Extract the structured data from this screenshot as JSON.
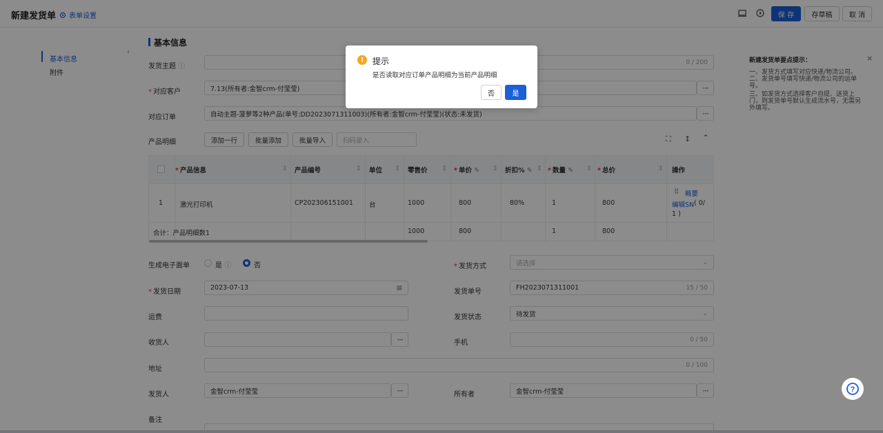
{
  "header": {
    "title": "新建发货单",
    "form_settings": "表单设置",
    "save": "保 存",
    "draft": "存草稿",
    "cancel": "取 消"
  },
  "nav": {
    "items": [
      "基本信息",
      "附件"
    ]
  },
  "section": {
    "title": "基本信息"
  },
  "form": {
    "subject_label": "发货主题",
    "subject_count": "0 / 200",
    "customer_label": "对应客户",
    "customer_value": "7.13(所有者:金智crm-付莹莹)",
    "order_label": "对应订单",
    "order_value": "自动主题-菠萝等2种产品(单号:DD2023071311003)(所有者:金智crm-付莹莹)(状态:未发货)",
    "product_detail_label": "产品明细",
    "add_row": "添加一行",
    "batch_add": "批量添加",
    "batch_import": "批量导入",
    "scan_placeholder": "扫码录入",
    "e_waybill_label": "生成电子面单",
    "e_waybill_yes": "是",
    "e_waybill_no": "否",
    "shipping_method_label": "发货方式",
    "shipping_method_placeholder": "请选择",
    "ship_date_label": "发货日期",
    "ship_date_value": "2023-07-13",
    "ship_no_label": "发货单号",
    "ship_no_value": "FH2023071311001",
    "ship_no_count": "15 / 50",
    "freight_label": "运费",
    "ship_status_label": "发货状态",
    "ship_status_value": "待发货",
    "receiver_label": "收货人",
    "phone_label": "手机",
    "phone_count": "0 / 50",
    "address_label": "地址",
    "address_count": "0 / 100",
    "sender_label": "发货人",
    "sender_value": "金智crm-付莹莹",
    "owner_label": "所有者",
    "owner_value": "金智crm-付莹莹",
    "remark_label": "备注"
  },
  "table": {
    "headers": [
      "产品信息",
      "产品编号",
      "单位",
      "零售价",
      "单价",
      "折扣%",
      "数量",
      "总价",
      "操作"
    ],
    "row": {
      "index": "1",
      "product": "激光打印机",
      "code": "CP202306151001",
      "unit": "台",
      "retail": "1000",
      "price": "800",
      "discount": "80%",
      "qty": "1",
      "total": "800",
      "op_summary": "概要",
      "op_sn": "编辑SN",
      "op_sn_count_a": "( 0/",
      "op_sn_count_b": "1 )"
    },
    "footer": {
      "label": "合计：产品明细数1",
      "retail": "1000",
      "price": "800",
      "qty": "1",
      "total": "800"
    }
  },
  "tips": {
    "title": "新建发货单要点提示：",
    "lines": [
      "一、发货方式填写对应快递/物流公司。",
      "二、发货单号填写快递/物流公司的运单号。",
      "三、如发货方式选择客户自提、送货上门，则发货单号默认生成流水号，无需另外填写。"
    ]
  },
  "modal": {
    "title": "提示",
    "message": "是否读取对应订单产品明细为当前产品明细",
    "no": "否",
    "yes": "是"
  },
  "colors": {
    "primary": "#1c5fd6",
    "warning": "#f5a623",
    "required": "#e0312b"
  }
}
